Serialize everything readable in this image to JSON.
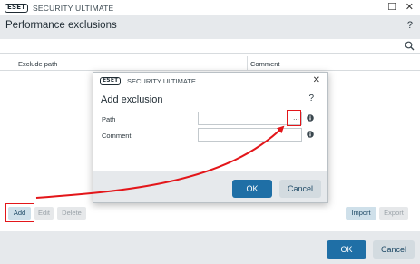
{
  "window": {
    "logo": "ESET",
    "app_title": "SECURITY ULTIMATE",
    "minimize_glyph": "☐",
    "close_glyph": "✕"
  },
  "page": {
    "title": "Performance exclusions",
    "help_glyph": "?"
  },
  "table": {
    "columns": [
      "Exclude path",
      "Comment"
    ],
    "rows": []
  },
  "toolbar": {
    "add": "Add",
    "edit": "Edit",
    "delete": "Delete",
    "import": "Import",
    "export": "Export"
  },
  "footer": {
    "ok": "OK",
    "cancel": "Cancel"
  },
  "dialog": {
    "logo": "ESET",
    "app_title": "SECURITY ULTIMATE",
    "close_glyph": "✕",
    "title": "Add exclusion",
    "help_glyph": "?",
    "fields": {
      "path_label": "Path",
      "path_value": "",
      "browse_glyph": "...",
      "comment_label": "Comment",
      "comment_value": ""
    },
    "ok": "OK",
    "cancel": "Cancel"
  },
  "colors": {
    "primary_button": "#1f6fa6",
    "annotation_red": "#e3161a",
    "band_gray": "#e6e9ec"
  },
  "icons": [
    "search-icon",
    "info-icon",
    "close-icon",
    "maximize-icon",
    "help-icon"
  ]
}
